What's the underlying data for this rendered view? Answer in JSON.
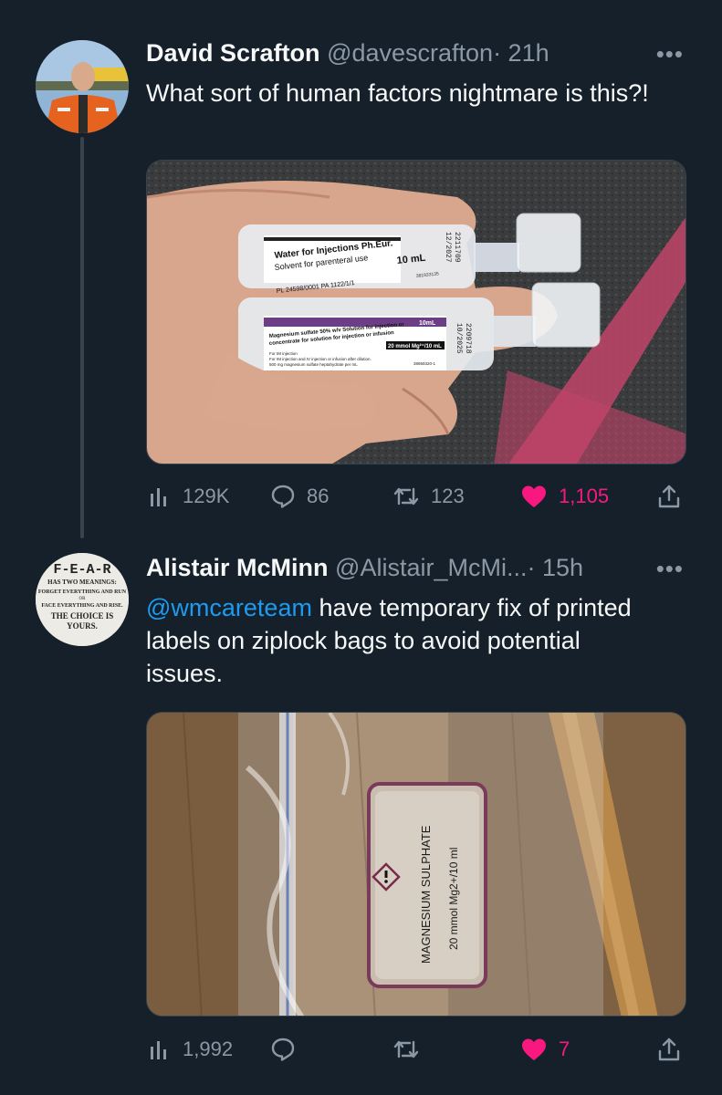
{
  "tweets": [
    {
      "author": "David Scrafton",
      "handle": "@davescrafton",
      "time": "· 21h",
      "more": "•••",
      "text": "What sort of human factors nightmare is this?!",
      "views": "129K",
      "replies": "86",
      "retweets": "123",
      "likes": "1,105",
      "image": {
        "vial1_label_title": "Water for Injections Ph.Eur.",
        "vial1_label_sub": "Solvent for parenteral use",
        "vial1_volume": "10 mL",
        "vial1_pl": "PL 24598/0001   PA 1122/1/1",
        "vial1_code": "381933135",
        "vial1_lot": "2211709",
        "vial1_exp": "12/2027",
        "vial2_volume": "10mL",
        "vial2_label_title": "Magnesium sulfate 50% w/v Solution for injection or",
        "vial2_label_sub": "concentrate for solution for injection or infusion",
        "vial2_strength": "20 mmol Mg²⁺/10 mL",
        "vial2_line1": "For IM injection",
        "vial2_line2": "For IM injection and IV injection or infusion after dilution.",
        "vial2_line3": "500 mg magnesium sulfate heptahydrate per mL",
        "vial2_code": "38959320-1",
        "vial2_lot": "2209718",
        "vial2_exp": "10/2025"
      }
    },
    {
      "author": "Alistair McMinn",
      "handle": "@Alistair_McMi...",
      "time": "· 15h",
      "more": "•••",
      "mention": "@wmcareteam",
      "text": " have temporary fix of printed labels on ziplock bags to avoid potential issues.",
      "views": "1,992",
      "replies": "",
      "retweets": "",
      "likes": "7",
      "avatar_text": {
        "line1": "F-E-A-R",
        "line2": "HAS TWO MEANINGS:",
        "line3": "FORGET EVERYTHING AND RUN",
        "line4": "OR",
        "line5": "FACE EVERYTHING AND RISE.",
        "line6": "THE CHOICE IS",
        "line7": "YOURS."
      },
      "image": {
        "label_title": "MAGNESIUM SULPHATE",
        "label_sub": "20 mmol Mg2+/10 ml"
      }
    }
  ],
  "colors": {
    "background": "#15202b",
    "text": "#f7f9f9",
    "muted": "#8b98a5",
    "link": "#1d9bf0",
    "like": "#f91880"
  }
}
